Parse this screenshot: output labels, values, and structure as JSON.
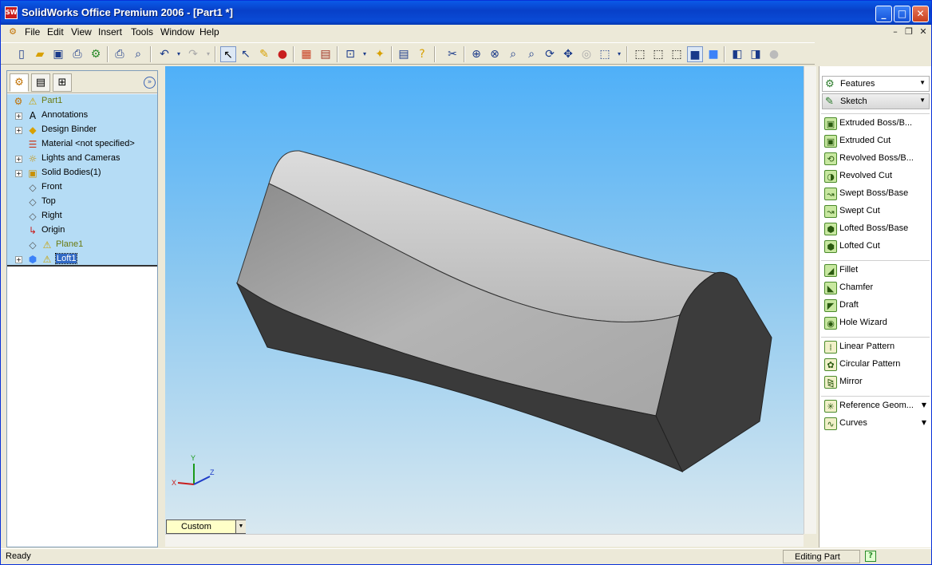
{
  "window": {
    "title": "SolidWorks Office Premium 2006 - [Part1 *]",
    "app_icon": "SW"
  },
  "menu": [
    "File",
    "Edit",
    "View",
    "Insert",
    "Tools",
    "Window",
    "Help"
  ],
  "toolbar_icons": [
    "new-icon",
    "open-icon",
    "save-icon",
    "print-icon",
    "options-icon",
    "print-preview-icon",
    "undo-icon",
    "redo-icon",
    "select-icon",
    "select-filter-icon",
    "rebuild-icon",
    "traffic-light-icon",
    "grid-icon",
    "brick-icon",
    "zoom-to-fit-icon",
    "zoom-area-icon",
    "zoom-in-icon",
    "rotate-icon",
    "pan-icon",
    "view-orientation-icon",
    "shaded-icon"
  ],
  "feature_manager": {
    "tabs": [
      "feature-tree-tab",
      "property-manager-tab",
      "configuration-tab"
    ],
    "tree": [
      {
        "label": "Part1",
        "icon": "part-icon",
        "warning": true,
        "expandable": false,
        "color": "#6a7a10"
      },
      {
        "label": "Annotations",
        "icon": "annotations-icon",
        "expandable": true
      },
      {
        "label": "Design Binder",
        "icon": "design-binder-icon",
        "expandable": true
      },
      {
        "label": "Material <not specified>",
        "icon": "material-icon",
        "expandable": false
      },
      {
        "label": "Lights and Cameras",
        "icon": "lights-icon",
        "expandable": true
      },
      {
        "label": "Solid Bodies(1)",
        "icon": "solid-bodies-icon",
        "expandable": true
      },
      {
        "label": "Front",
        "icon": "plane-icon",
        "expandable": false
      },
      {
        "label": "Top",
        "icon": "plane-icon",
        "expandable": false
      },
      {
        "label": "Right",
        "icon": "plane-icon",
        "expandable": false
      },
      {
        "label": "Origin",
        "icon": "origin-icon",
        "expandable": false
      },
      {
        "label": "Plane1",
        "icon": "plane-icon",
        "warning": true,
        "expandable": false,
        "color": "#6a7a10"
      },
      {
        "label": "Loft1",
        "icon": "loft-icon",
        "warning": true,
        "expandable": true,
        "selected": true
      }
    ]
  },
  "viewport": {
    "view_selector": "Custom",
    "triad": {
      "x": "X",
      "y": "Y",
      "z": "Z"
    }
  },
  "command_manager": {
    "headers": [
      {
        "label": "Features",
        "icon": "features-icon"
      },
      {
        "label": "Sketch",
        "icon": "sketch-icon"
      }
    ],
    "groups": [
      [
        {
          "label": "Extruded Boss/B...",
          "icon": "extruded-boss-icon"
        },
        {
          "label": "Extruded Cut",
          "icon": "extruded-cut-icon"
        },
        {
          "label": "Revolved Boss/B...",
          "icon": "revolved-boss-icon"
        },
        {
          "label": "Revolved Cut",
          "icon": "revolved-cut-icon"
        },
        {
          "label": "Swept Boss/Base",
          "icon": "swept-boss-icon"
        },
        {
          "label": "Swept Cut",
          "icon": "swept-cut-icon"
        },
        {
          "label": "Lofted Boss/Base",
          "icon": "lofted-boss-icon"
        },
        {
          "label": "Lofted Cut",
          "icon": "lofted-cut-icon"
        }
      ],
      [
        {
          "label": "Fillet",
          "icon": "fillet-icon"
        },
        {
          "label": "Chamfer",
          "icon": "chamfer-icon"
        },
        {
          "label": "Draft",
          "icon": "draft-icon"
        },
        {
          "label": "Hole Wizard",
          "icon": "hole-wizard-icon"
        }
      ],
      [
        {
          "label": "Linear Pattern",
          "icon": "linear-pattern-icon"
        },
        {
          "label": "Circular Pattern",
          "icon": "circular-pattern-icon"
        },
        {
          "label": "Mirror",
          "icon": "mirror-icon"
        }
      ],
      [
        {
          "label": "Reference Geom...",
          "icon": "reference-geometry-icon",
          "dropdown": true
        },
        {
          "label": "Curves",
          "icon": "curves-icon",
          "dropdown": true
        }
      ]
    ]
  },
  "status": {
    "text": "Ready",
    "mode": "Editing Part",
    "help": "?"
  }
}
